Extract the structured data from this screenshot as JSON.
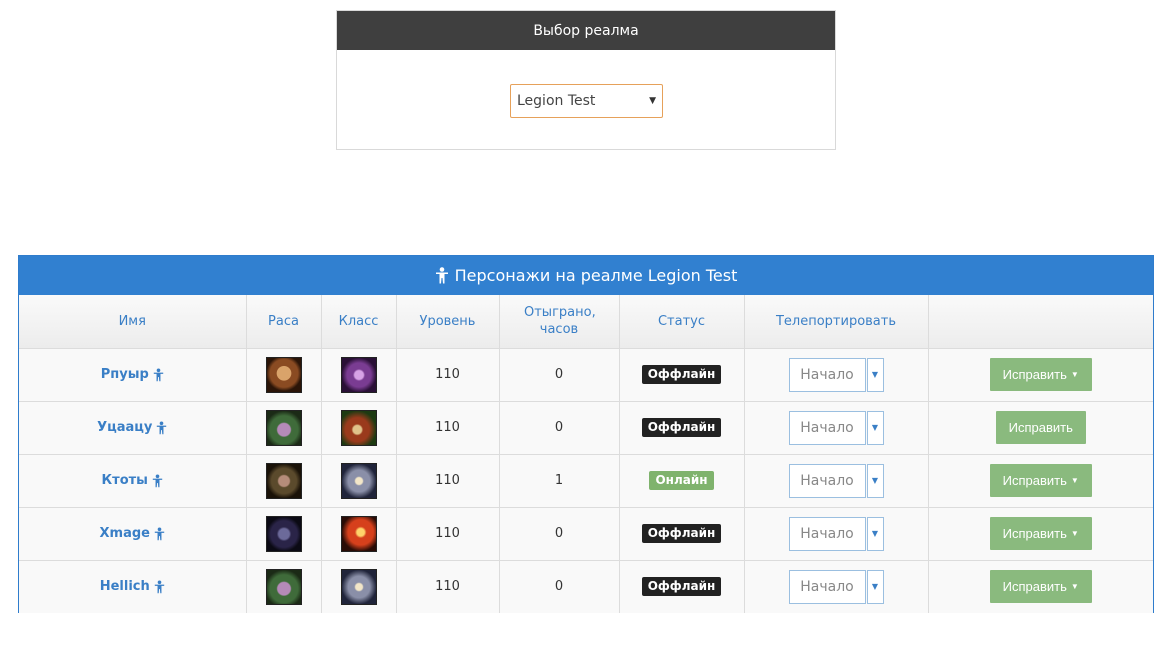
{
  "realm_panel": {
    "title": "Выбор реалма",
    "selected_realm": "Legion Test"
  },
  "characters_panel": {
    "title": "Персонажи на реалме Legion Test",
    "columns": [
      "Имя",
      "Раса",
      "Класс",
      "Уровень",
      "Отыграно, часов",
      "Статус",
      "Телепортировать",
      ""
    ],
    "rows": [
      {
        "name": "Рпуыр",
        "level": "110",
        "played": "0",
        "status": "Оффлайн",
        "teleport": "Начало",
        "action": "Исправить",
        "action_dropdown": true,
        "race_portrait": "pandaren-male",
        "class_icon": "shadow-priest"
      },
      {
        "name": "Уцаацу",
        "level": "110",
        "played": "0",
        "status": "Оффлайн",
        "teleport": "Начало",
        "action": "Исправить",
        "action_dropdown": false,
        "race_portrait": "night-elf-female",
        "class_icon": "hunter"
      },
      {
        "name": "Ктоты",
        "level": "110",
        "played": "1",
        "status": "Онлайн",
        "teleport": "Начало",
        "action": "Исправить",
        "action_dropdown": true,
        "race_portrait": "night-elf-male",
        "class_icon": "paladin"
      },
      {
        "name": "Xmage",
        "level": "110",
        "played": "0",
        "status": "Оффлайн",
        "teleport": "Начало",
        "action": "Исправить",
        "action_dropdown": true,
        "race_portrait": "night-elf-dark-female",
        "class_icon": "warrior"
      },
      {
        "name": "Hellich",
        "level": "110",
        "played": "0",
        "status": "Оффлайн",
        "teleport": "Начало",
        "action": "Исправить",
        "action_dropdown": true,
        "race_portrait": "night-elf-female",
        "class_icon": "paladin"
      }
    ]
  },
  "colors": {
    "realm_header": "#3f3f3f",
    "chars_header": "#3180d0",
    "link": "#3a7fc6",
    "status_offline": "#222222",
    "status_online": "#7fb36d",
    "action_button": "#8aba7e"
  }
}
